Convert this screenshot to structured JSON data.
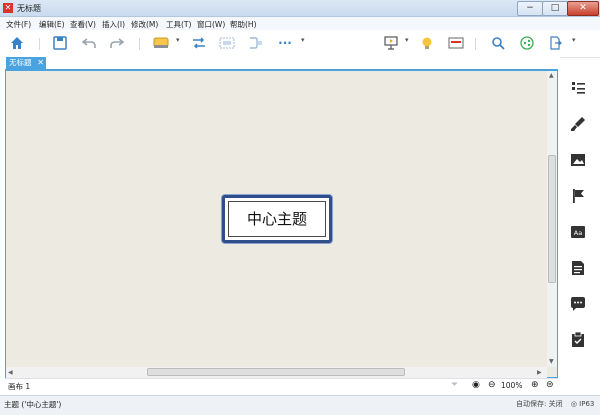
{
  "window": {
    "title": "无标题",
    "app_icon": "xmind-logo-icon"
  },
  "menu": [
    "文件(F)",
    "编辑(E)",
    "查看(V)",
    "插入(I)",
    "修改(M)",
    "工具(T)",
    "窗口(W)",
    "帮助(H)"
  ],
  "toolbar": {
    "items": [
      "home-icon",
      "save-icon",
      "undo-icon",
      "redo-icon",
      "topic-style-icon",
      "relationship-icon",
      "boundary-icon",
      "summary-icon",
      "more-icon",
      "presentation-icon",
      "idea-lightbulb-icon",
      "outline-view-icon",
      "search-icon",
      "share-icon",
      "export-icon"
    ]
  },
  "tab": {
    "label": "无标题",
    "close": "✕"
  },
  "canvas": {
    "central_topic": "中心主题",
    "background": "#edebe1",
    "topic_border": "#2f4e8b"
  },
  "status_canvas": {
    "sheet_label": "画布 1",
    "zoom": "100%"
  },
  "status": {
    "selection": "主题 ('中心主题')",
    "autosave": "自动保存: 关闭",
    "ip": "IP63"
  },
  "sidebar": [
    "outline-list-icon",
    "format-brush-icon",
    "image-icon",
    "flag-marker-icon",
    "text-aa-icon",
    "notes-icon",
    "comments-icon",
    "task-clipboard-icon"
  ],
  "colors": {
    "accent": "#4aa3df",
    "close": "#c9402c"
  }
}
